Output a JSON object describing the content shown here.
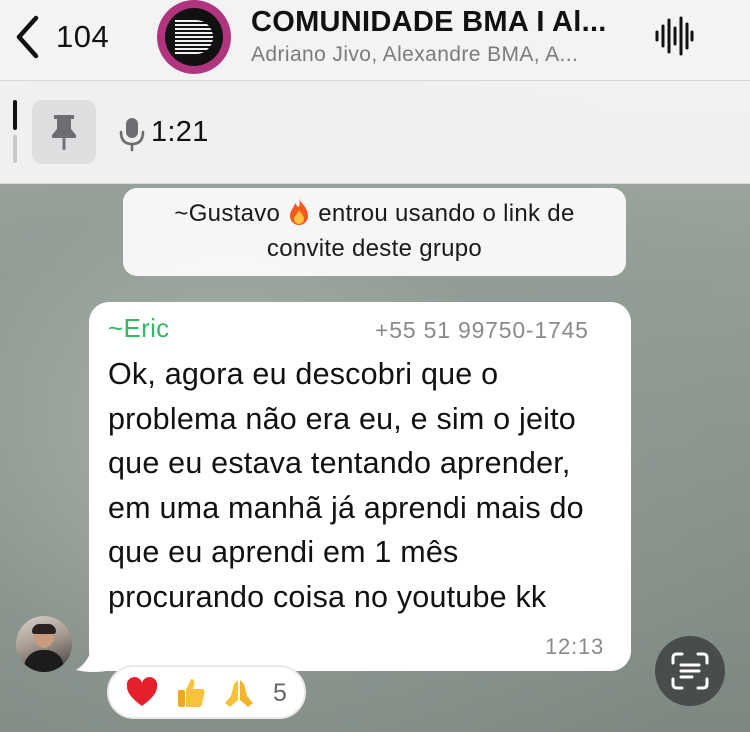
{
  "header": {
    "back_count": "104",
    "title": "COMUNIDADE BMA I Al...",
    "subtitle": "Adriano Jivo, Alexandre BMA, A..."
  },
  "pinned": {
    "voice_duration": "1:21"
  },
  "system_message": {
    "prefix": "~Gustavo",
    "emoji": "fire-emoji",
    "suffix": "entrou usando o link de",
    "line2": "convite deste grupo"
  },
  "message": {
    "sender": "~Eric",
    "phone": "+55 51 99750-1745",
    "text": "Ok, agora eu descobri que o problema não era eu, e sim o jeito que eu estava tentando aprender, em uma manhã já aprendi mais do que eu aprendi em 1 mês procurando coisa no youtube kk",
    "time": "12:13",
    "reactions": {
      "emojis": [
        "heart-emoji",
        "thumbs-up-emoji",
        "praying-hands-emoji"
      ],
      "count": "5"
    }
  },
  "colors": {
    "sender_name": "#2fbb62",
    "group_avatar": "#b0357e",
    "header_bg": "#f3f3f4"
  }
}
